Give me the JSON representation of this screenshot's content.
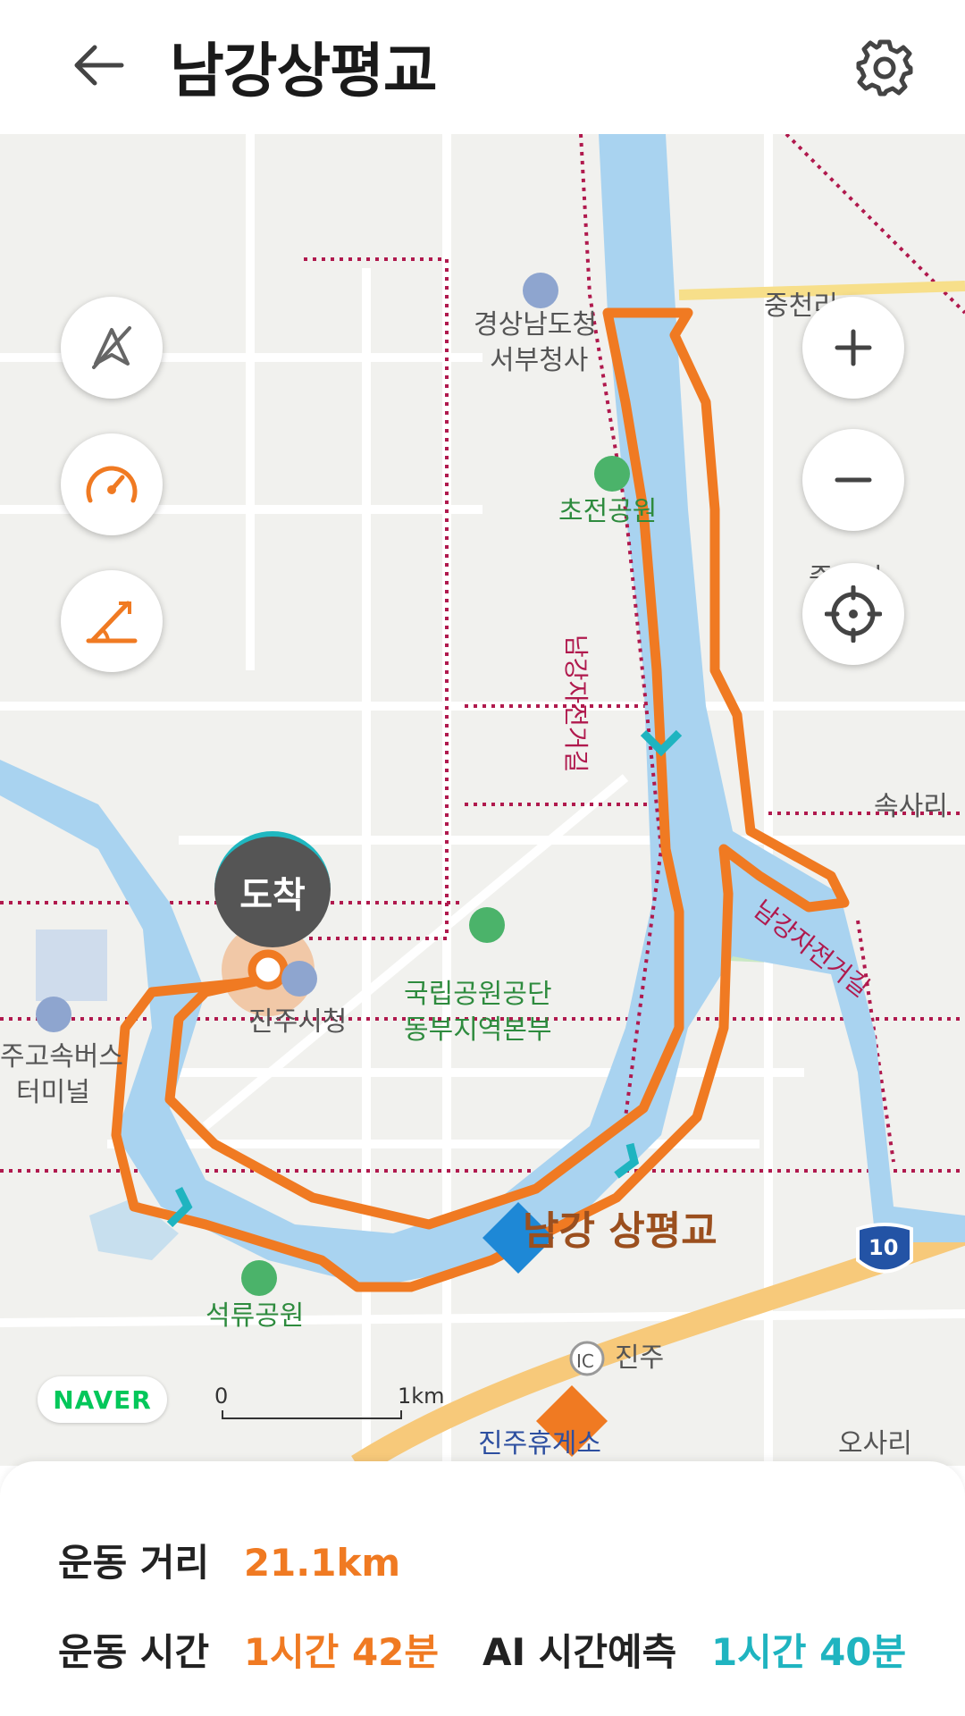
{
  "header": {
    "title": "남강상평교",
    "back_icon": "arrow-left-icon",
    "settings_icon": "gear-icon"
  },
  "map": {
    "labels": {
      "gyeongnam": "경상남도청",
      "seobu": "서부청사",
      "chojeon_park": "초전공원",
      "national_park": "국립공원공단",
      "dongbu": "동부지역본부",
      "jinju_cityhall": "진주시청",
      "bus_terminal_1": "주고속버스",
      "bus_terminal_2": "터미널",
      "seokryu_park": "석류공원",
      "jinju_ic": "진주",
      "rest_area": "진주휴게소",
      "jungcheon": "중천리",
      "jungdeok": "중덕리",
      "soksa": "속사리",
      "osa": "오사리",
      "route_name": "남강 상평교",
      "highway": "10",
      "ic_badge": "IC",
      "bike_road_1": "남강자전거길",
      "bike_road_2": "남강자전거길"
    },
    "destination_label": "도착",
    "naver_logo": "NAVER",
    "scale": {
      "start": "0",
      "end": "1km"
    },
    "colors": {
      "route": "#f07a22",
      "river": "#a9d3f0",
      "bike_path": "#b0194d",
      "accent_teal": "#1fb4c0"
    }
  },
  "controls": {
    "compass_icon": "compass-off-icon",
    "speed_icon": "speedometer-icon",
    "slope_icon": "slope-icon",
    "zoom_in_icon": "plus-icon",
    "zoom_out_icon": "minus-icon",
    "locate_icon": "crosshair-icon"
  },
  "stats": {
    "distance_label": "운동 거리",
    "distance_value": "21.1km",
    "time_label": "운동 시간",
    "time_value": "1시간 42분",
    "ai_label": "AI 시간예측",
    "ai_value": "1시간 40분"
  }
}
